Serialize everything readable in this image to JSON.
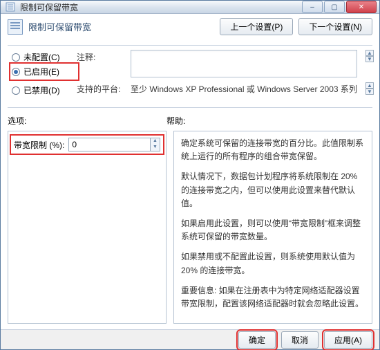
{
  "window": {
    "title": "限制可保留带宽",
    "controls": {
      "min": "–",
      "max": "▢",
      "close": "✕"
    }
  },
  "header": {
    "title": "限制可保留带宽",
    "prev_btn": "上一个设置(P)",
    "next_btn": "下一个设置(N)"
  },
  "radios": {
    "not_configured": "未配置(C)",
    "enabled": "已启用(E)",
    "disabled": "已禁用(D)",
    "selected": "enabled"
  },
  "labels": {
    "comment": "注释:",
    "platform": "支持的平台:",
    "options": "选项:",
    "help": "帮助:"
  },
  "platform_text": "至少 Windows XP Professional 或 Windows Server 2003 系列",
  "option": {
    "limit_label": "带宽限制 (%):",
    "limit_value": "0"
  },
  "help_paragraphs": [
    "确定系统可保留的连接带宽的百分比。此值限制系统上运行的所有程序的组合带宽保留。",
    "默认情况下，数据包计划程序将系统限制在 20% 的连接带宽之内，但可以使用此设置来替代默认值。",
    "如果启用此设置，则可以使用“带宽限制”框来调整系统可保留的带宽数量。",
    "如果禁用或不配置此设置，则系统使用默认值为 20% 的连接带宽。",
    "重要信息: 如果在注册表中为特定网络适配器设置带宽限制，配置该网络适配器时就会忽略此设置。"
  ],
  "footer": {
    "ok": "确定",
    "cancel": "取消",
    "apply": "应用(A)"
  }
}
